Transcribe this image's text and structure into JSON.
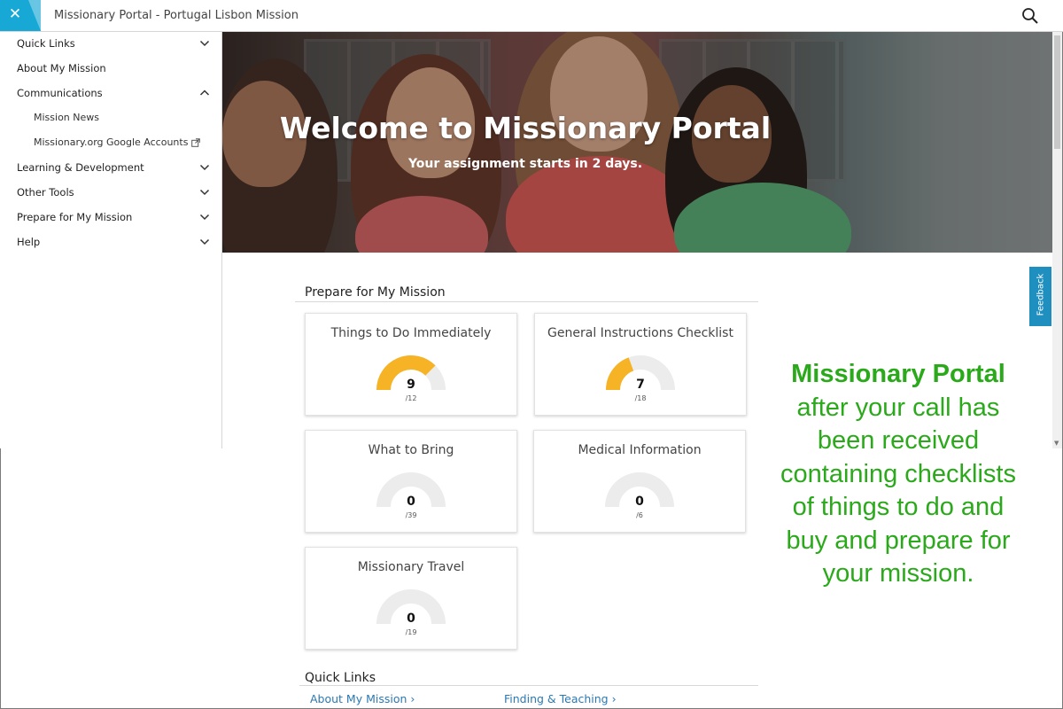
{
  "header": {
    "title": "Missionary Portal - Portugal Lisbon Mission",
    "close_icon": "close-icon",
    "search_icon": "search-icon",
    "accent": "#17a8d6"
  },
  "sidebar": {
    "items": [
      {
        "label": "Quick Links",
        "state": "collapsed"
      },
      {
        "label": "About My Mission"
      },
      {
        "label": "Communications",
        "state": "expanded"
      },
      {
        "label": "Mission News"
      },
      {
        "label": "Missionary.org Google Accounts"
      },
      {
        "label": "Learning & Development",
        "state": "collapsed"
      },
      {
        "label": "Other Tools",
        "state": "collapsed"
      },
      {
        "label": "Prepare for My Mission",
        "state": "collapsed"
      },
      {
        "label": "Help",
        "state": "collapsed"
      }
    ]
  },
  "hero": {
    "title": "Welcome to Missionary Portal",
    "subtitle": "Your assignment starts in 2 days."
  },
  "feedback": {
    "label": "Feedback"
  },
  "prepare": {
    "title": "Prepare for My Mission",
    "cards": [
      {
        "title": "Things to Do Immediately",
        "count": "9",
        "total": "/12"
      },
      {
        "title": "General Instructions Checklist",
        "count": "7",
        "total": "/18"
      },
      {
        "title": "What to Bring",
        "count": "0",
        "total": "/39"
      },
      {
        "title": "Medical Information",
        "count": "0",
        "total": "/6"
      },
      {
        "title": "Missionary Travel",
        "count": "0",
        "total": "/19"
      }
    ],
    "gauge_colors": {
      "filled": "#f5b325",
      "empty": "#ececec"
    }
  },
  "quick_links": {
    "title": "Quick Links",
    "links": [
      {
        "label": "About My Mission ›"
      },
      {
        "label": "Finding & Teaching ›"
      }
    ]
  },
  "caption": {
    "bold": "Missionary Portal",
    "text": "after your call has been received containing checklists of things to do and buy and prepare for your mission.",
    "color": "#2aa91a"
  }
}
